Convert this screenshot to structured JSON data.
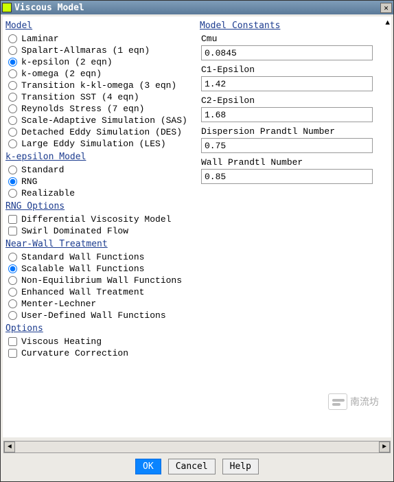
{
  "title": "Viscous Model",
  "groups": {
    "model": {
      "title": "Model",
      "options": [
        {
          "label": "Laminar",
          "checked": false
        },
        {
          "label": "Spalart-Allmaras (1 eqn)",
          "checked": false
        },
        {
          "label": "k-epsilon (2 eqn)",
          "checked": true
        },
        {
          "label": "k-omega (2 eqn)",
          "checked": false
        },
        {
          "label": "Transition k-kl-omega (3 eqn)",
          "checked": false
        },
        {
          "label": "Transition SST (4 eqn)",
          "checked": false
        },
        {
          "label": "Reynolds Stress (7 eqn)",
          "checked": false
        },
        {
          "label": "Scale-Adaptive Simulation (SAS)",
          "checked": false
        },
        {
          "label": "Detached Eddy Simulation (DES)",
          "checked": false
        },
        {
          "label": "Large Eddy Simulation (LES)",
          "checked": false
        }
      ]
    },
    "kepsilon": {
      "title": "k-epsilon Model",
      "options": [
        {
          "label": "Standard",
          "checked": false
        },
        {
          "label": "RNG",
          "checked": true
        },
        {
          "label": "Realizable",
          "checked": false
        }
      ]
    },
    "rng": {
      "title": "RNG Options",
      "options": [
        {
          "label": "Differential Viscosity Model",
          "checked": false
        },
        {
          "label": "Swirl Dominated Flow",
          "checked": false
        }
      ]
    },
    "nearwall": {
      "title": "Near-Wall Treatment",
      "options": [
        {
          "label": "Standard Wall Functions",
          "checked": false
        },
        {
          "label": "Scalable Wall Functions",
          "checked": true
        },
        {
          "label": "Non-Equilibrium Wall Functions",
          "checked": false
        },
        {
          "label": "Enhanced Wall Treatment",
          "checked": false
        },
        {
          "label": "Menter-Lechner",
          "checked": false
        },
        {
          "label": "User-Defined Wall Functions",
          "checked": false
        }
      ]
    },
    "options": {
      "title": "Options",
      "options": [
        {
          "label": "Viscous Heating",
          "checked": false
        },
        {
          "label": "Curvature Correction",
          "checked": false
        }
      ]
    }
  },
  "constants": {
    "title": "Model Constants",
    "fields": [
      {
        "label": "Cmu",
        "value": "0.0845"
      },
      {
        "label": "C1-Epsilon",
        "value": "1.42"
      },
      {
        "label": "C2-Epsilon",
        "value": "1.68"
      },
      {
        "label": "Dispersion Prandtl Number",
        "value": "0.75"
      },
      {
        "label": "Wall Prandtl Number",
        "value": "0.85"
      }
    ]
  },
  "buttons": {
    "ok": "OK",
    "cancel": "Cancel",
    "help": "Help"
  },
  "watermark": "南流坊"
}
